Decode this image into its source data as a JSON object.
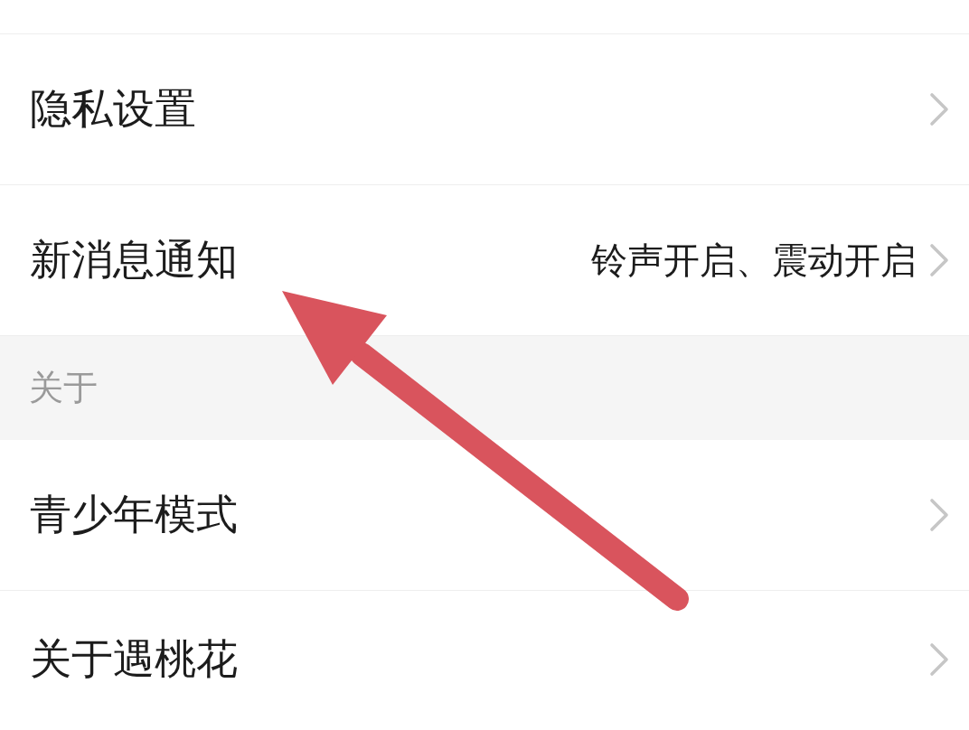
{
  "sections": [
    {
      "items": [
        {
          "label": "隐私设置"
        },
        {
          "label": "新消息通知",
          "value": "铃声开启、震动开启"
        }
      ]
    },
    {
      "header": "关于",
      "items": [
        {
          "label": "青少年模式"
        },
        {
          "label": "关于遇桃花"
        }
      ]
    }
  ]
}
